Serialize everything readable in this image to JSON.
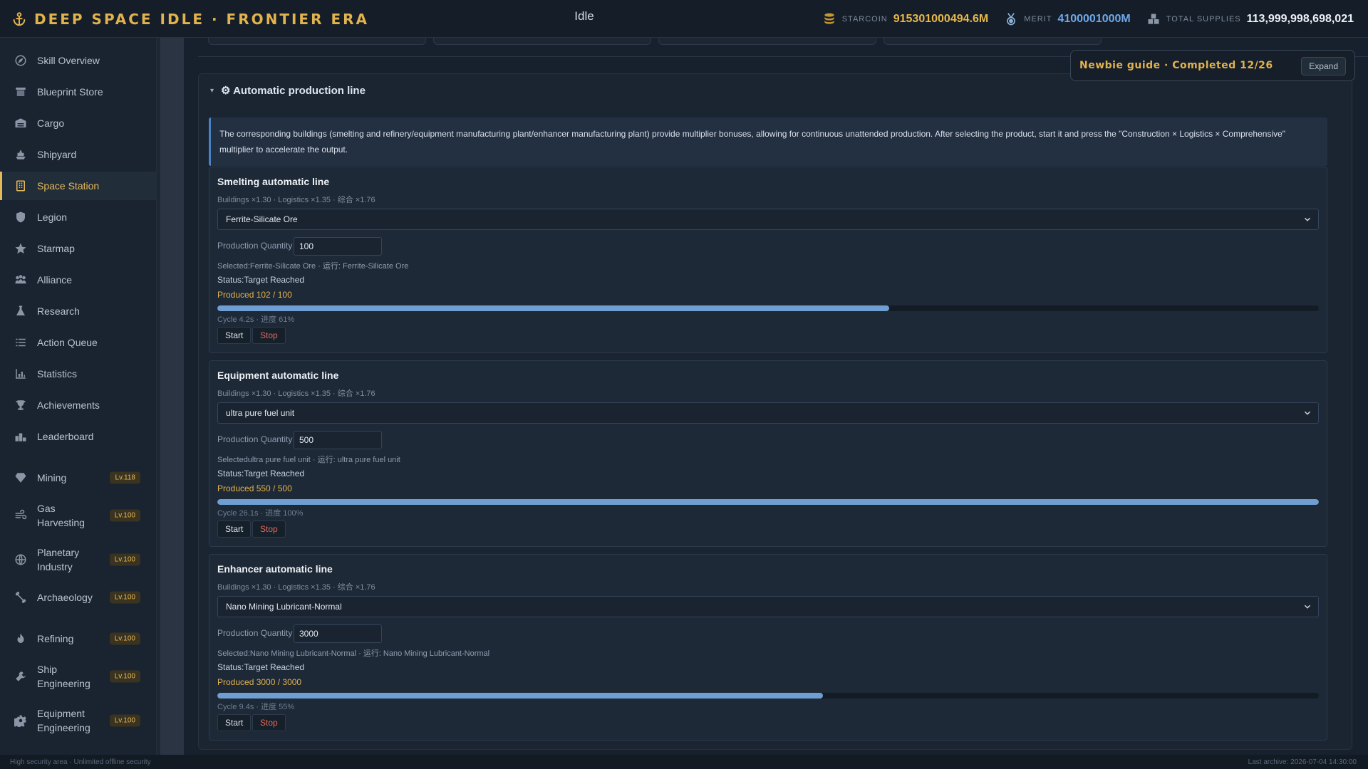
{
  "header": {
    "title": "DEEP SPACE IDLE · FRONTIER ERA",
    "status": "Idle",
    "stats": {
      "starcoin_label": "STARCOIN",
      "starcoin_value": "915301000494.6M",
      "merit_label": "MERIT",
      "merit_value": "4100001000M",
      "supplies_label": "TOTAL SUPPLIES",
      "supplies_value": "113,999,998,698,021"
    }
  },
  "sidebar": {
    "items": [
      {
        "label": "Skill Overview",
        "icon": "compass-icon"
      },
      {
        "label": "Blueprint Store",
        "icon": "store-icon"
      },
      {
        "label": "Cargo",
        "icon": "cargo-icon"
      },
      {
        "label": "Shipyard",
        "icon": "ship-icon"
      },
      {
        "label": "Space Station",
        "icon": "station-icon",
        "active": true
      },
      {
        "label": "Legion",
        "icon": "shield-icon"
      },
      {
        "label": "Starmap",
        "icon": "star-icon"
      },
      {
        "label": "Alliance",
        "icon": "people-icon"
      },
      {
        "label": "Research",
        "icon": "flask-icon"
      },
      {
        "label": "Action Queue",
        "icon": "list-icon"
      },
      {
        "label": "Statistics",
        "icon": "chart-icon"
      },
      {
        "label": "Achievements",
        "icon": "trophy-icon"
      },
      {
        "label": "Leaderboard",
        "icon": "podium-icon"
      }
    ],
    "skills": [
      {
        "label": "Mining",
        "level": "Lv.118",
        "icon": "gem-icon"
      },
      {
        "label": "Gas Harvesting",
        "level": "Lv.100",
        "icon": "wind-icon"
      },
      {
        "label": "Planetary Industry",
        "level": "Lv.100",
        "icon": "globe-icon"
      },
      {
        "label": "Archaeology",
        "level": "Lv.100",
        "icon": "bone-icon"
      },
      {
        "label": "Refining",
        "level": "Lv.100",
        "icon": "flame-icon"
      },
      {
        "label": "Ship Engineering",
        "level": "Lv.100",
        "icon": "wrench-icon"
      },
      {
        "label": "Equipment Engineering",
        "level": "Lv.100",
        "icon": "gear-icon"
      }
    ]
  },
  "section": {
    "title": "⚙ Automatic production line",
    "caret": "▾",
    "info": "The corresponding buildings (smelting and refinery/equipment manufacturing plant/enhancer manufacturing plant) provide multiplier bonuses, allowing for continuous unattended production. After selecting the product, start it and press the \"Construction × Logistics × Comprehensive\" multiplier to accelerate the output."
  },
  "lines": [
    {
      "title": "Smelting automatic line",
      "multipliers": "Buildings ×1.30 · Logistics ×1.35 · 综合 ×1.76",
      "product": "Ferrite-Silicate Ore",
      "qty_label": "Production Quantity",
      "qty": "100",
      "selected": "Selected:Ferrite-Silicate Ore · 运行:  Ferrite-Silicate Ore",
      "status": "Status:Target Reached",
      "produced": "Produced 102 / 100",
      "progress": 0.61,
      "cycle": "Cycle 4.2s · 进度 61%",
      "start": "Start",
      "stop": "Stop"
    },
    {
      "title": "Equipment automatic line",
      "multipliers": "Buildings ×1.30 · Logistics ×1.35 · 综合 ×1.76",
      "product": "ultra pure fuel unit",
      "qty_label": "Production Quantity",
      "qty": "500",
      "selected": "Selectedultra pure fuel unit · 运行:  ultra pure fuel unit",
      "status": "Status:Target Reached",
      "produced": "Produced 550 / 500",
      "progress": 1.0,
      "cycle": "Cycle 26.1s · 进度 100%",
      "start": "Start",
      "stop": "Stop"
    },
    {
      "title": "Enhancer automatic line",
      "multipliers": "Buildings ×1.30 · Logistics ×1.35 · 综合 ×1.76",
      "product": "Nano Mining Lubricant-Normal",
      "qty_label": "Production Quantity",
      "qty": "3000",
      "selected": "Selected:Nano Mining Lubricant-Normal · 运行:  Nano Mining Lubricant-Normal",
      "status": "Status:Target Reached",
      "produced": "Produced 3000 / 3000",
      "progress": 0.55,
      "cycle": "Cycle 9.4s · 进度 55%",
      "start": "Start",
      "stop": "Stop"
    }
  ],
  "guide": {
    "text": "Newbie guide · Completed 12/26",
    "button": "Expand"
  },
  "footer": {
    "left": "High security area · Unlimited offline security",
    "right": "Last archive: 2026-07-04 14:30:00"
  },
  "colors": {
    "accent": "#e2b24c",
    "progress": "#6f9fd2",
    "stop": "#e06a5a"
  }
}
